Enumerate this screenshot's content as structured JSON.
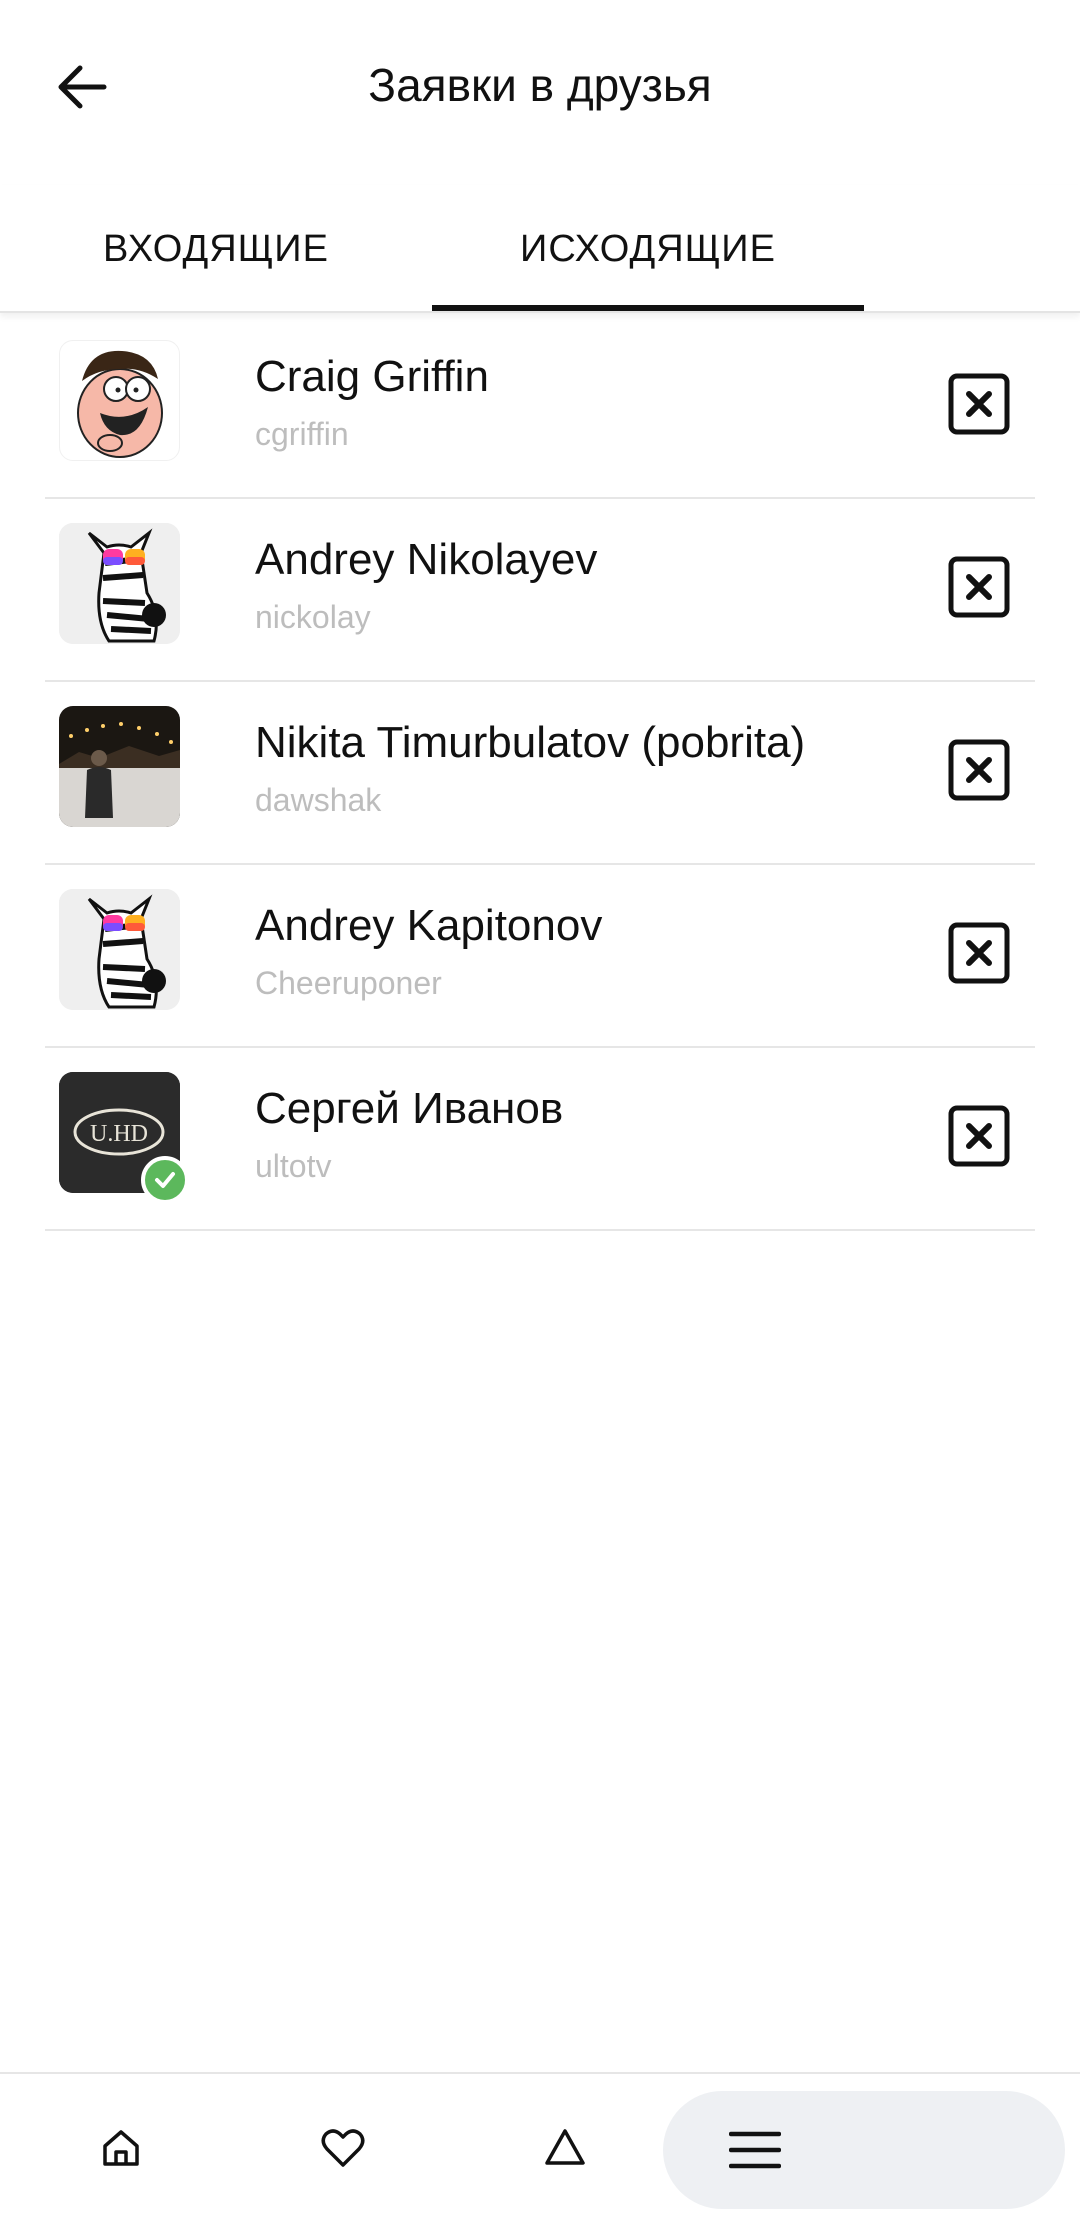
{
  "header": {
    "title": "Заявки в друзья"
  },
  "tabs": [
    {
      "label": "ВХОДЯЩИЕ",
      "active": false
    },
    {
      "label": "ИСХОДЯЩИЕ",
      "active": true
    }
  ],
  "requests": [
    {
      "name": "Craig Griffin",
      "username": "cgriffin",
      "avatar": "cartoon-face",
      "verified": false
    },
    {
      "name": "Andrey Nikolayev",
      "username": "nickolay",
      "avatar": "zebra-sunglasses",
      "verified": false
    },
    {
      "name": "Nikita Timurbulatov (pobrita)",
      "username": "dawshak",
      "avatar": "night-photo",
      "verified": false
    },
    {
      "name": "Andrey Kapitonov",
      "username": "Cheeruponer",
      "avatar": "zebra-sunglasses",
      "verified": false
    },
    {
      "name": "Сергей Иванов",
      "username": "ultotv",
      "avatar": "uhd-logo",
      "avatar_text": "U.HD",
      "verified": true
    }
  ],
  "bottom_nav": [
    {
      "icon": "home-icon"
    },
    {
      "icon": "heart-icon"
    },
    {
      "icon": "triangle-icon"
    },
    {
      "icon": "menu-icon",
      "highlighted": true
    }
  ],
  "colors": {
    "text": "#111111",
    "secondary_text": "#bdbdbd",
    "divider": "#e6e6e6",
    "verified": "#5cb85c",
    "nav_pill": "#eef0f3"
  }
}
